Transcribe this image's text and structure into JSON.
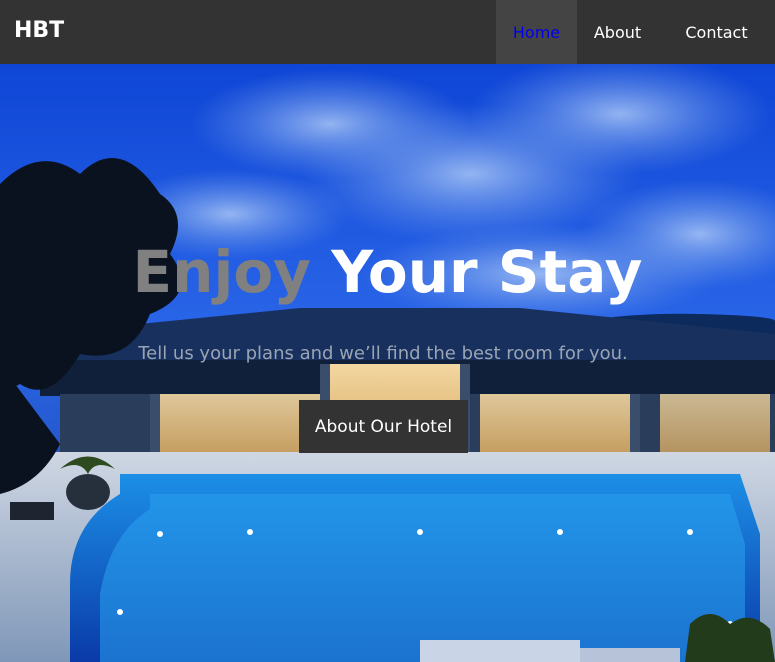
{
  "brand": "HBT",
  "nav": {
    "items": [
      {
        "label": "Home",
        "active": true
      },
      {
        "label": "About",
        "active": false
      },
      {
        "label": "Contact",
        "active": false
      }
    ]
  },
  "hero": {
    "title_part1": "Enjoy",
    "title_part2": "Your Stay",
    "subtitle": "Tell us your plans and we’ll find the best room for you.",
    "button_label": "About Our Hotel",
    "image": "hotel-pool-night-photo"
  },
  "colors": {
    "navbar": "#333333",
    "nav_active_bg": "#444444",
    "nav_active_text": "#0000ee",
    "title_accent": "#808080",
    "button_bg": "#333333"
  }
}
